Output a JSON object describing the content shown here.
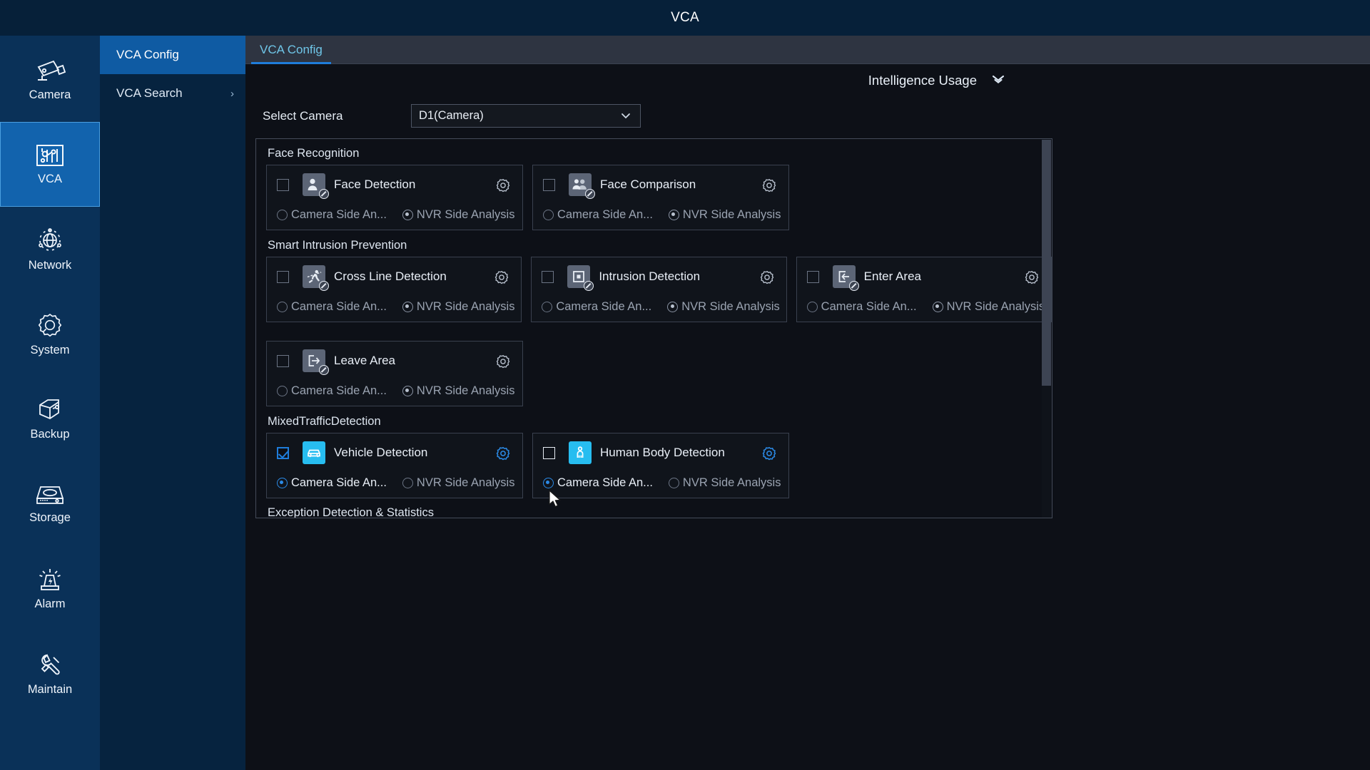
{
  "window": {
    "title": "VCA"
  },
  "sidebar": {
    "items": [
      {
        "label": "Camera",
        "icon": "camera-icon",
        "active": false
      },
      {
        "label": "VCA",
        "icon": "vca-icon",
        "active": true
      },
      {
        "label": "Network",
        "icon": "network-icon",
        "active": false
      },
      {
        "label": "System",
        "icon": "system-gear-icon",
        "active": false
      },
      {
        "label": "Backup",
        "icon": "backup-icon",
        "active": false
      },
      {
        "label": "Storage",
        "icon": "storage-icon",
        "active": false
      },
      {
        "label": "Alarm",
        "icon": "alarm-icon",
        "active": false
      },
      {
        "label": "Maintain",
        "icon": "maintain-wrench-icon",
        "active": false
      }
    ]
  },
  "submenu": {
    "items": [
      {
        "label": "VCA Config",
        "active": true,
        "chevron": ""
      },
      {
        "label": "VCA Search",
        "active": false,
        "chevron": "›"
      }
    ]
  },
  "tab": {
    "label": "VCA Config"
  },
  "intelligence_usage": {
    "label": "Intelligence Usage",
    "chevron_icon": "double-chevron-down-icon"
  },
  "select_camera": {
    "label": "Select Camera",
    "value": "D1(Camera)",
    "options": [
      "D1(Camera)"
    ],
    "chevron_icon": "chevron-down-icon"
  },
  "labels": {
    "camera_side": "Camera Side An...",
    "nvr_side": "NVR Side Analysis",
    "settings_icon": "gear-icon"
  },
  "groups": [
    {
      "title": "Face Recognition",
      "cards": [
        {
          "name": "Face Detection",
          "icon": "face-detection-icon",
          "checked": false,
          "enabled": false,
          "mode": "nvr"
        },
        {
          "name": "Face Comparison",
          "icon": "face-comparison-icon",
          "checked": false,
          "enabled": false,
          "mode": "nvr"
        }
      ]
    },
    {
      "title": "Smart Intrusion Prevention",
      "cards": [
        {
          "name": "Cross Line Detection",
          "icon": "cross-line-detection-icon",
          "checked": false,
          "enabled": false,
          "mode": "nvr"
        },
        {
          "name": "Intrusion Detection",
          "icon": "intrusion-detection-icon",
          "checked": false,
          "enabled": false,
          "mode": "nvr"
        },
        {
          "name": "Enter Area",
          "icon": "enter-area-icon",
          "checked": false,
          "enabled": false,
          "mode": "nvr"
        }
      ]
    },
    {
      "title": "",
      "cards": [
        {
          "name": "Leave Area",
          "icon": "leave-area-icon",
          "checked": false,
          "enabled": false,
          "mode": "nvr"
        }
      ]
    },
    {
      "title": "MixedTrafficDetection",
      "cards": [
        {
          "name": "Vehicle Detection",
          "icon": "vehicle-detection-icon",
          "checked": true,
          "enabled": true,
          "mode": "camera"
        },
        {
          "name": "Human Body Detection",
          "icon": "human-body-detection-icon",
          "checked": false,
          "enabled": true,
          "mode": "camera"
        }
      ]
    }
  ],
  "footer_group": {
    "title": "Exception Detection & Statistics"
  },
  "colors": {
    "accent": "#1f7ddb",
    "icon_on": "#27bdf0",
    "sidebar": "#0a3158",
    "titlebar": "#062039",
    "tab_text": "#6fc6e8"
  }
}
